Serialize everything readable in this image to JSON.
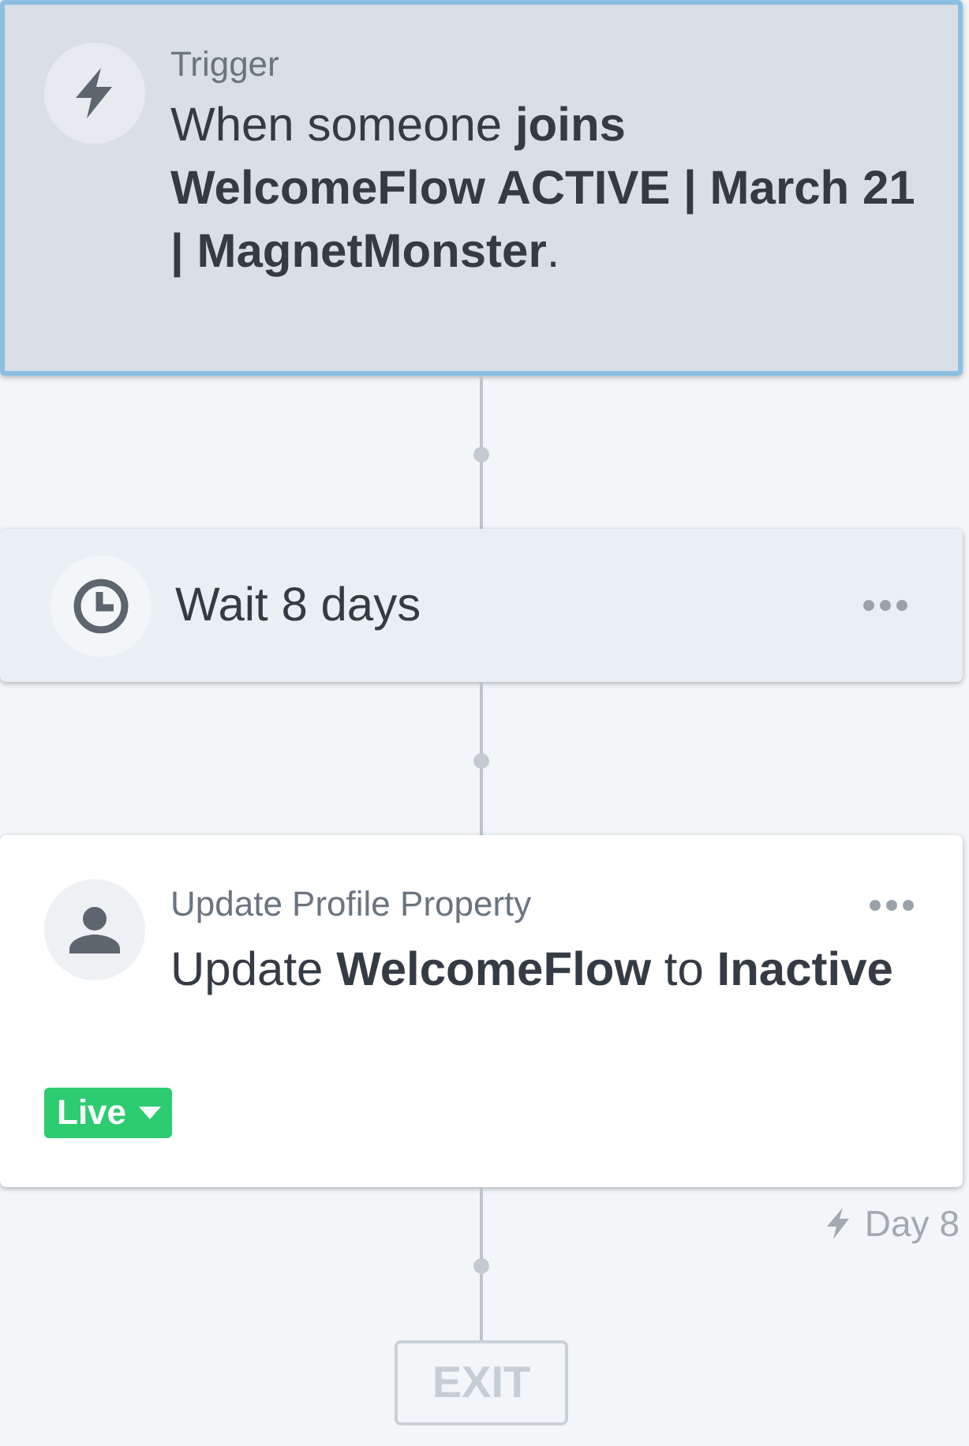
{
  "flow": {
    "steps": [
      {
        "kind": "trigger",
        "selected": true,
        "label": "Trigger",
        "text": "When someone **joins** **WelcomeFlow ACTIVE | March 21 | MagnetMonster**.",
        "menu": false
      },
      {
        "kind": "delay",
        "selected": false,
        "text": "Wait 8 days",
        "menu": true
      },
      {
        "kind": "update",
        "selected": false,
        "label": "Update Profile Property",
        "text": "Update **WelcomeFlow** to **Inactive**",
        "menu": true,
        "status": "Live",
        "timing": "Day 8"
      }
    ],
    "exit": {
      "label": "EXIT"
    }
  }
}
